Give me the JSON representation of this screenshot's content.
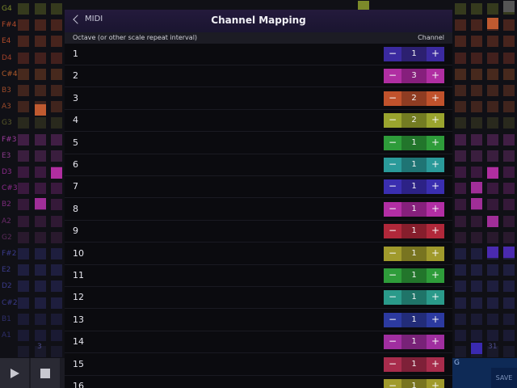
{
  "modal": {
    "back_label": "MIDI",
    "title": "Channel Mapping",
    "column_left": "Octave (or other scale repeat interval)",
    "column_right": "Channel"
  },
  "rows": [
    {
      "label": "1",
      "channel": "1",
      "color": "#3b2aa0",
      "mid": "#2c2070"
    },
    {
      "label": "2",
      "channel": "3",
      "color": "#b02ea2",
      "mid": "#861f7c"
    },
    {
      "label": "3",
      "channel": "2",
      "color": "#c0522c",
      "mid": "#8e3c22"
    },
    {
      "label": "4",
      "channel": "2",
      "color": "#9aa42e",
      "mid": "#737c22"
    },
    {
      "label": "5",
      "channel": "1",
      "color": "#2e9c3a",
      "mid": "#22752b"
    },
    {
      "label": "6",
      "channel": "1",
      "color": "#2a9a9a",
      "mid": "#1f7474"
    },
    {
      "label": "7",
      "channel": "1",
      "color": "#3a2eb0",
      "mid": "#2c2286"
    },
    {
      "label": "8",
      "channel": "1",
      "color": "#b22ea4",
      "mid": "#86207c"
    },
    {
      "label": "9",
      "channel": "1",
      "color": "#b0283a",
      "mid": "#861e2c"
    },
    {
      "label": "10",
      "channel": "1",
      "color": "#a09a2c",
      "mid": "#787420"
    },
    {
      "label": "11",
      "channel": "1",
      "color": "#2e9c3a",
      "mid": "#22752b"
    },
    {
      "label": "12",
      "channel": "1",
      "color": "#2a9a8a",
      "mid": "#1f7468"
    },
    {
      "label": "13",
      "channel": "1",
      "color": "#2c3aa0",
      "mid": "#222c78"
    },
    {
      "label": "14",
      "channel": "1",
      "color": "#a02ea0",
      "mid": "#782278"
    },
    {
      "label": "15",
      "channel": "1",
      "color": "#a82c4c",
      "mid": "#7e2038"
    },
    {
      "label": "16",
      "channel": "1",
      "color": "#a09a2c",
      "mid": "#787420"
    }
  ],
  "background": {
    "note_labels": [
      {
        "text": "G4",
        "color": "#7c8a2a"
      },
      {
        "text": "F#4",
        "color": "#b04a2a"
      },
      {
        "text": "E4",
        "color": "#b04a2a"
      },
      {
        "text": "D4",
        "color": "#a0402a"
      },
      {
        "text": "C#4",
        "color": "#b05a2a"
      },
      {
        "text": "B3",
        "color": "#9a4a2a"
      },
      {
        "text": "A3",
        "color": "#9a4a2a"
      },
      {
        "text": "G3",
        "color": "#5a5a2a"
      },
      {
        "text": "F#3",
        "color": "#9a3a9a"
      },
      {
        "text": "E3",
        "color": "#8a3a8a"
      },
      {
        "text": "D3",
        "color": "#8a2a8a"
      },
      {
        "text": "C#3",
        "color": "#8a2a8a"
      },
      {
        "text": "B2",
        "color": "#7a2a7a"
      },
      {
        "text": "A2",
        "color": "#6a2a6a"
      },
      {
        "text": "G2",
        "color": "#5a2a5a"
      },
      {
        "text": "F#2",
        "color": "#3a3a8a"
      },
      {
        "text": "E2",
        "color": "#3a3a8a"
      },
      {
        "text": "D2",
        "color": "#3a3a8a"
      },
      {
        "text": "C#2",
        "color": "#3a3a8a"
      },
      {
        "text": "B1",
        "color": "#2e2e6a"
      },
      {
        "text": "A1",
        "color": "#2e2e6a"
      }
    ],
    "bottom_left_num": "3",
    "bottom_right_num": "31",
    "right_label": "G",
    "save_label": "SAVE"
  }
}
